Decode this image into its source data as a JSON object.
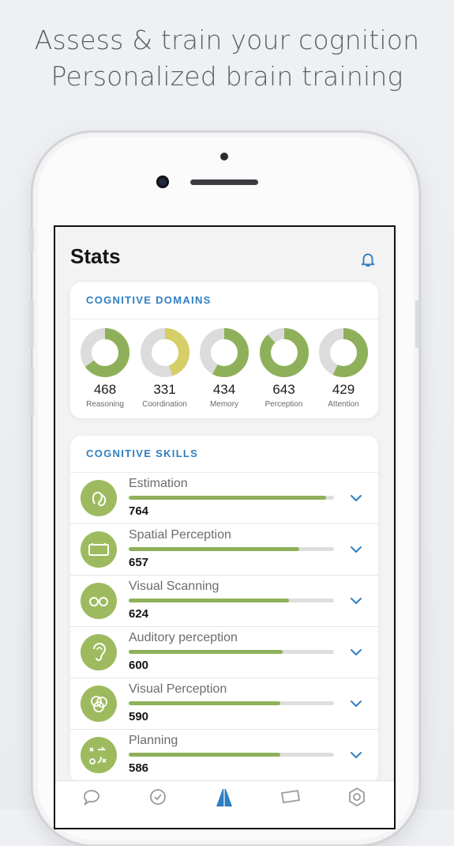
{
  "headline": {
    "line1": "Assess & train your cognition",
    "line2": "Personalized brain training"
  },
  "screen": {
    "title": "Stats",
    "bell_icon": "bell-icon"
  },
  "domains": {
    "header": "COGNITIVE DOMAINS",
    "items": [
      {
        "value": "468",
        "label": "Reasoning",
        "fraction": 0.65,
        "color": "#8fb05a"
      },
      {
        "value": "331",
        "label": "Coordination",
        "fraction": 0.45,
        "color": "#d6cf68"
      },
      {
        "value": "434",
        "label": "Memory",
        "fraction": 0.58,
        "color": "#8fb05a"
      },
      {
        "value": "643",
        "label": "Perception",
        "fraction": 0.88,
        "color": "#8fb05a"
      },
      {
        "value": "429",
        "label": "Attention",
        "fraction": 0.57,
        "color": "#8fb05a"
      }
    ]
  },
  "skills": {
    "header": "COGNITIVE SKILLS",
    "items": [
      {
        "name": "Estimation",
        "value": "764",
        "fraction": 0.96,
        "icon": "estimation-icon"
      },
      {
        "name": "Spatial Perception",
        "value": "657",
        "fraction": 0.83,
        "icon": "battery-icon"
      },
      {
        "name": "Visual Scanning",
        "value": "624",
        "fraction": 0.78,
        "icon": "glasses-icon"
      },
      {
        "name": "Auditory perception",
        "value": "600",
        "fraction": 0.75,
        "icon": "ear-icon"
      },
      {
        "name": "Visual Perception",
        "value": "590",
        "fraction": 0.74,
        "icon": "circles-icon"
      },
      {
        "name": "Planning",
        "value": "586",
        "fraction": 0.74,
        "icon": "planning-icon"
      }
    ]
  },
  "tabbar": {
    "items": [
      "chat-icon",
      "check-icon",
      "stats-icon",
      "ticket-icon",
      "settings-icon"
    ]
  },
  "colors": {
    "accent": "#2f7ec2",
    "green": "#8fb05a",
    "yellow": "#d6cf68"
  }
}
